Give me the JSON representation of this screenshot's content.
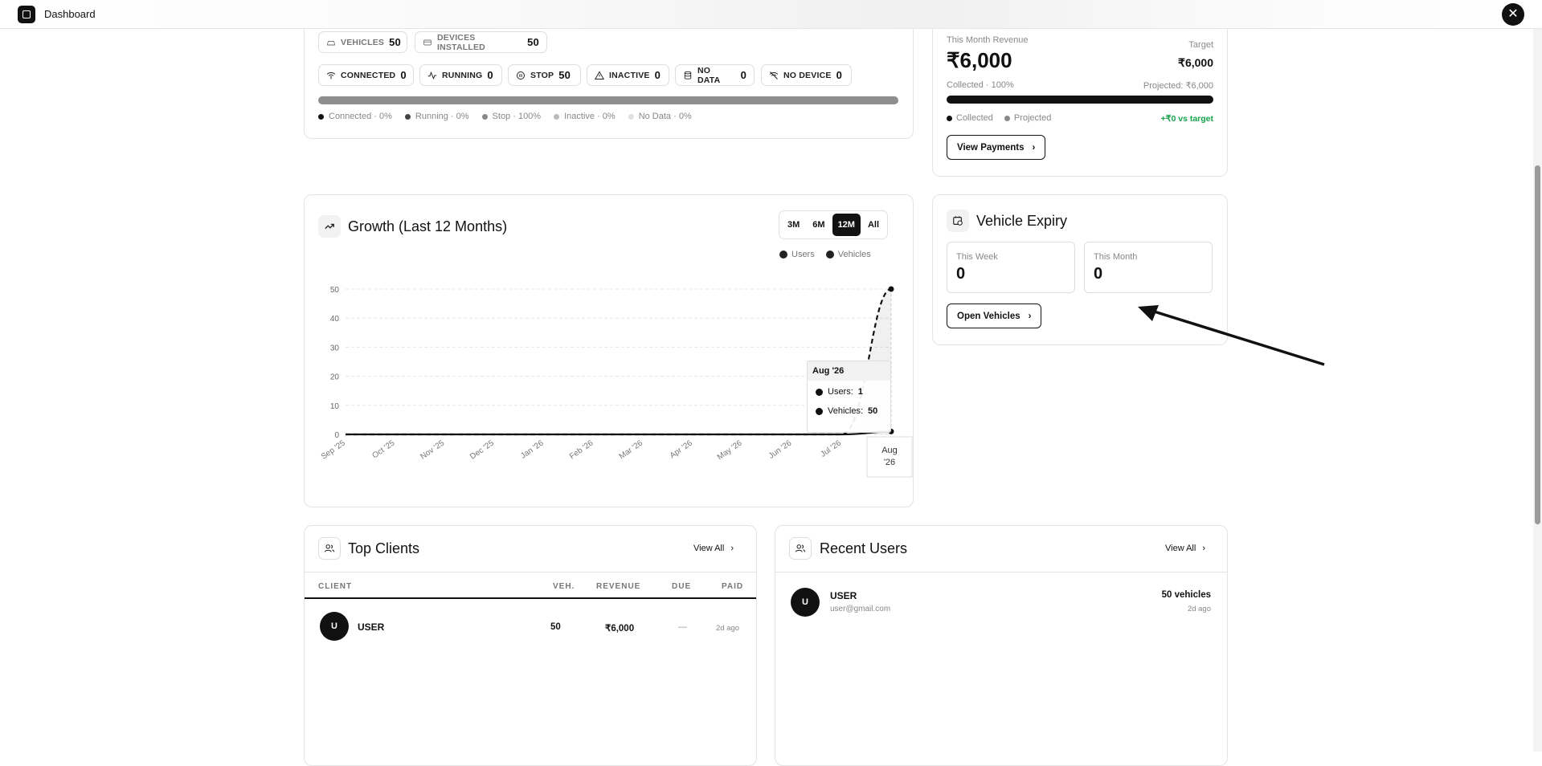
{
  "app": {
    "title": "Dashboard"
  },
  "fleet": {
    "chips_row1": [
      {
        "label": "VEHICLES",
        "value": "50",
        "icon": "car-icon"
      },
      {
        "label": "DEVICES INSTALLED",
        "value": "50",
        "icon": "device-icon"
      }
    ],
    "chips_row2": [
      {
        "label": "CONNECTED",
        "value": "0",
        "icon": "wifi-icon"
      },
      {
        "label": "RUNNING",
        "value": "0",
        "icon": "activity-icon"
      },
      {
        "label": "STOP",
        "value": "50",
        "icon": "stop-icon"
      },
      {
        "label": "INACTIVE",
        "value": "0",
        "icon": "warning-icon"
      },
      {
        "label": "NO DATA",
        "value": "0",
        "icon": "database-icon"
      },
      {
        "label": "NO DEVICE",
        "value": "0",
        "icon": "wifi-off-icon"
      }
    ],
    "status_bar_fill": 1.0,
    "legend": [
      {
        "label": "Connected · 0%",
        "color": "#111111"
      },
      {
        "label": "Running · 0%",
        "color": "#444444"
      },
      {
        "label": "Stop · 100%",
        "color": "#888888"
      },
      {
        "label": "Inactive · 0%",
        "color": "#bbbbbb"
      },
      {
        "label": "No Data · 0%",
        "color": "#e0e0e0"
      }
    ]
  },
  "revenue": {
    "label": "This Month Revenue",
    "amount": "₹6,000",
    "target_label": "Target",
    "target_amount": "₹6,000",
    "collected": "Collected · 100%",
    "projected": "Projected: ₹6,000",
    "progress": 1.0,
    "legend_collected": "Collected",
    "legend_projected": "Projected",
    "delta": "+₹0 vs target",
    "delta_color": "#16a34a",
    "button": "View Payments"
  },
  "growth": {
    "title": "Growth (Last 12 Months)",
    "ranges": [
      "3M",
      "6M",
      "12M",
      "All"
    ],
    "active_range": "12M",
    "tooltip": {
      "title": "Aug '26",
      "users": "Users:",
      "users_value": "1",
      "vehicles": "Vehicles:",
      "vehicles_value": "50"
    }
  },
  "chart_data": {
    "type": "line",
    "categories": [
      "Sep '25",
      "Oct '25",
      "Nov '25",
      "Dec '25",
      "Jan '26",
      "Feb '26",
      "Mar '26",
      "Apr '26",
      "May '26",
      "Jun '26",
      "Jul '26",
      "Aug '26"
    ],
    "series": [
      {
        "name": "Users",
        "values": [
          0,
          0,
          0,
          0,
          0,
          0,
          0,
          0,
          0,
          0,
          0,
          1
        ]
      },
      {
        "name": "Vehicles",
        "values": [
          0,
          0,
          0,
          0,
          0,
          0,
          0,
          0,
          0,
          0,
          0,
          50
        ]
      }
    ],
    "yticks": [
      "0",
      "10",
      "20",
      "30",
      "40",
      "50"
    ],
    "ylim": [
      0,
      50
    ],
    "grid": true,
    "legend": "top-right"
  },
  "expiry": {
    "title": "Vehicle Expiry",
    "week_label": "This Week",
    "week_value": "0",
    "month_label": "This Month",
    "month_value": "0",
    "button": "Open Vehicles"
  },
  "top_clients": {
    "title": "Top Clients",
    "view_all": "View All",
    "headers": [
      "CLIENT",
      "VEH.",
      "REVENUE",
      "DUE",
      "PAID"
    ],
    "rows": [
      {
        "initial": "U",
        "name": "USER",
        "veh": "50",
        "revenue": "₹6,000",
        "due": "—",
        "paid": "2d ago"
      }
    ]
  },
  "recent_users": {
    "title": "Recent Users",
    "view_all": "View All",
    "rows": [
      {
        "initial": "U",
        "name": "USER",
        "email": "user@gmail.com",
        "vehicles": "50 vehicles",
        "time": "2d ago"
      }
    ]
  }
}
